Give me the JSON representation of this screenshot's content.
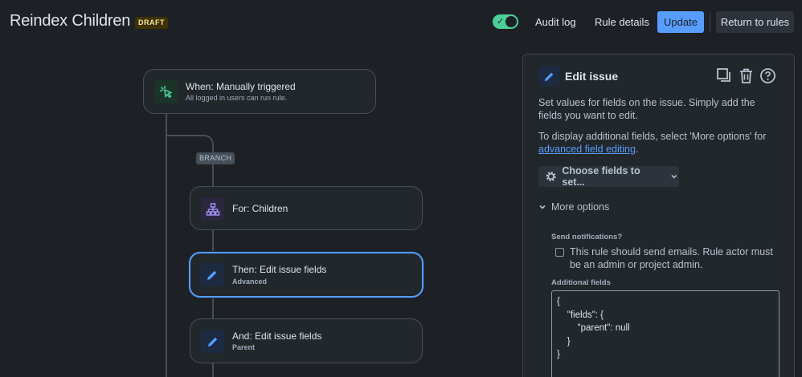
{
  "header": {
    "title": "Reindex Children",
    "status_badge": "DRAFT",
    "toggle_state": "on",
    "audit_log_label": "Audit log",
    "rule_details_label": "Rule details",
    "update_label": "Update",
    "return_label": "Return to rules",
    "accent_color": "#579dff"
  },
  "flow": {
    "trigger": {
      "title": "When: Manually triggered",
      "subtitle": "All logged in users can run rule.",
      "icon": "cursor-click-icon"
    },
    "branch_label": "BRANCH",
    "branch": {
      "title": "For: Children",
      "icon": "hierarchy-icon"
    },
    "action1": {
      "title": "Then: Edit issue fields",
      "subtitle": "Advanced",
      "icon": "pencil-icon",
      "selected": true
    },
    "action2": {
      "title": "And: Edit issue fields",
      "subtitle": "Parent",
      "icon": "pencil-icon"
    }
  },
  "panel": {
    "title": "Edit issue",
    "description": "Set values for fields on the issue. Simply add the fields you want to edit.",
    "display_text": "To display additional fields, select 'More options' for ",
    "display_link": "advanced field editing",
    "display_suffix": ".",
    "choose_fields_label": "Choose fields to set...",
    "more_options_label": "More options",
    "send_notifications_label": "Send notifications?",
    "send_notifications_text": "This rule should send emails. Rule actor must be an admin or project admin.",
    "send_notifications_checked": false,
    "additional_fields_label": "Additional fields",
    "additional_fields_value": "{\n    \"fields\": {\n        \"parent\": null\n    }\n}"
  }
}
